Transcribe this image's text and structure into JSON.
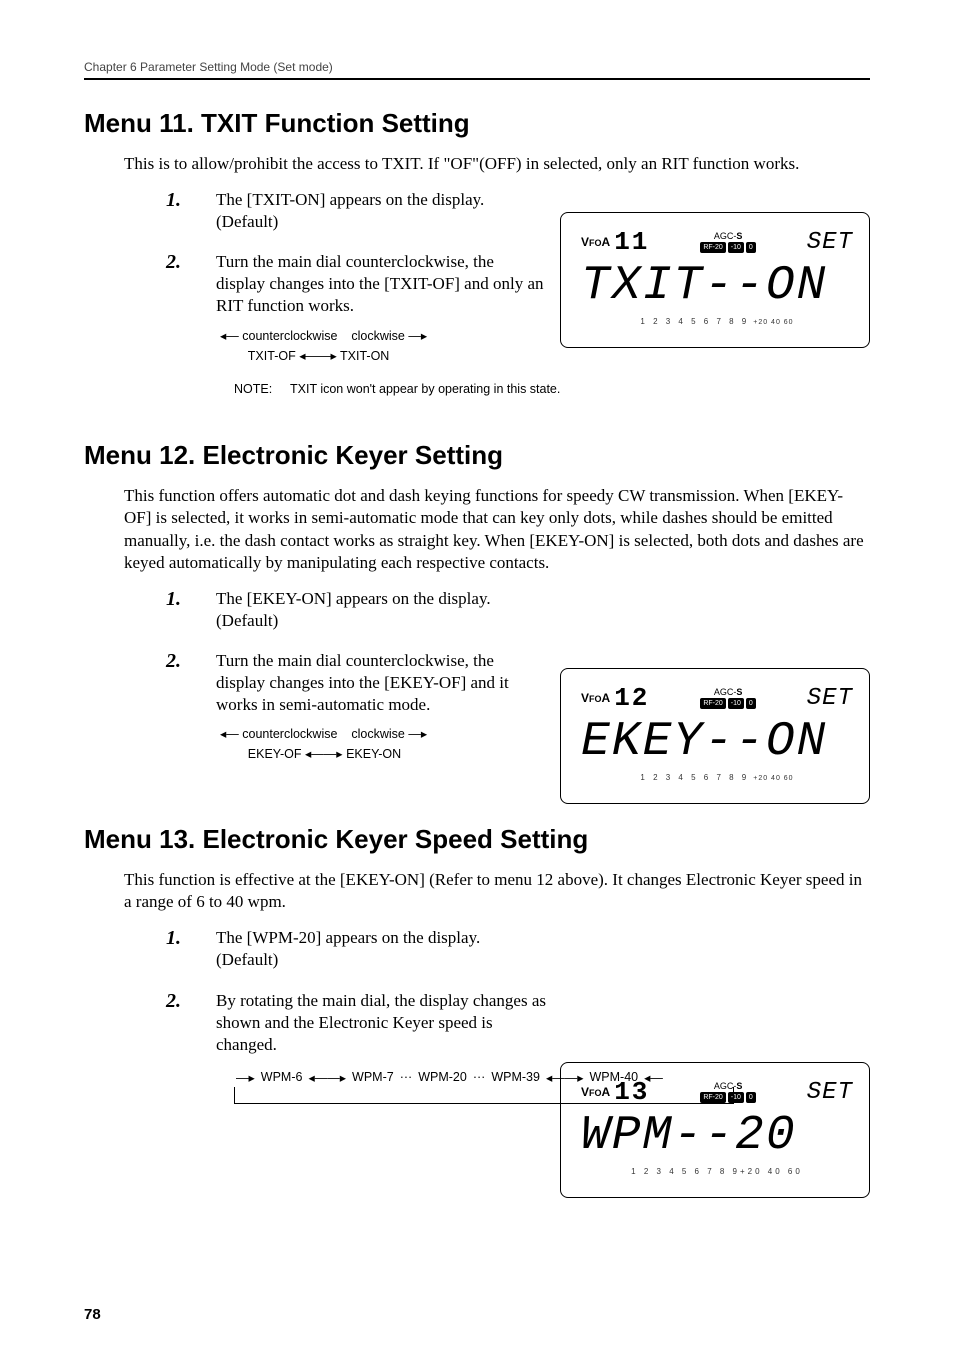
{
  "chapter_header": "Chapter 6   Parameter Setting Mode (Set mode)",
  "page_number": "78",
  "menu11": {
    "heading": "Menu 11.  TXIT Function Setting",
    "intro": "This is to allow/prohibit the access to TXIT. If \"OF\"(OFF) in selected, only an RIT function works.",
    "step1": "The [TXIT-ON] appears on the display. (Default)",
    "step2": "Turn the main dial counterclockwise, the display changes into the [TXIT-OF] and only an RIT function works.",
    "dial_ccw": "counterclockwise",
    "dial_cw": "clockwise",
    "dial_left": "TXIT-OF",
    "dial_right": "TXIT-ON",
    "note_label": "NOTE:",
    "note_text": "TXIT icon won't appear by operating in this state.",
    "lcd": {
      "vfo": "VFOA",
      "num": "11",
      "set": "SET",
      "main": "TXIT--ON",
      "meter": "1 2 3 4 5 6 7 8 9",
      "meter_sup": "+20  40  60"
    }
  },
  "menu12": {
    "heading": "Menu 12.  Electronic Keyer Setting",
    "intro": "This function offers automatic dot and dash keying functions for speedy CW transmission. When [EKEY-OF] is selected, it works in semi-automatic mode that can key only dots, while dashes should be emitted manually, i.e. the dash contact works as straight key. When [EKEY-ON] is selected, both dots and dashes are keyed automatically by manipulating each respective contacts.",
    "step1": "The [EKEY-ON] appears on the display. (Default)",
    "step2": "Turn the main dial counterclockwise, the display changes into the [EKEY-OF] and it works in semi-automatic mode.",
    "dial_ccw": "counterclockwise",
    "dial_cw": "clockwise",
    "dial_left": "EKEY-OF",
    "dial_right": "EKEY-ON",
    "lcd": {
      "vfo": "VFOA",
      "num": "12",
      "set": "SET",
      "main": "EKEY--ON",
      "meter": "1 2 3 4 5 6 7 8 9",
      "meter_sup": "+20  40  60"
    }
  },
  "menu13": {
    "heading": "Menu 13.  Electronic Keyer Speed Setting",
    "intro": "This function is effective at the [EKEY-ON] (Refer to menu 12 above). It changes Electronic Keyer speed in a range of 6 to 40 wpm.",
    "step1": "The [WPM-20] appears on the display. (Default)",
    "step2": "By rotating the main dial, the display changes as shown and the Electronic Keyer speed is changed.",
    "cycle": {
      "a": "WPM-6",
      "b": "WPM-7",
      "mid": "WPM-20",
      "d": "WPM-39",
      "e": "WPM-40"
    },
    "lcd": {
      "vfo": "VFOA",
      "num": "13",
      "set": "SET",
      "main": "WPM--20",
      "meter": "1 2 3 4 5 6 7 8 9",
      "meter_sup": "+20  40  60"
    }
  }
}
